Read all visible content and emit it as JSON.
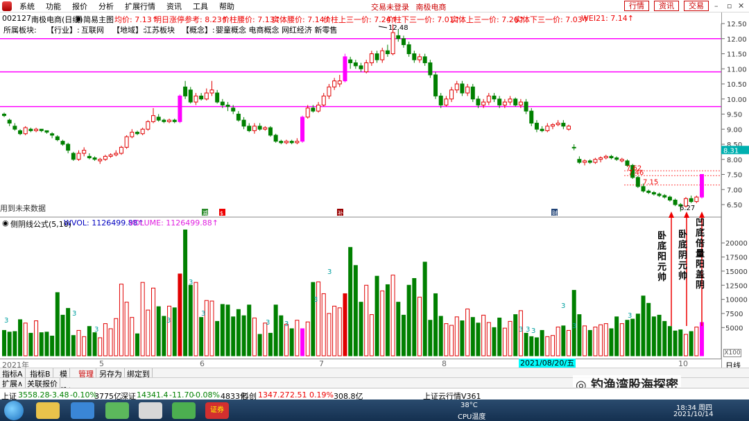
{
  "menubar": {
    "items": [
      "系统",
      "功能",
      "报价",
      "分析",
      "扩展行情",
      "资讯",
      "工具",
      "帮助"
    ],
    "center_status": "交易未登录",
    "center_name": "南极电商",
    "buttons": [
      "行情",
      "资讯",
      "交易"
    ]
  },
  "infobar": {
    "code": "002127",
    "name": "南极电商(日线)",
    "template": "简易主图",
    "avg_price": "均价: 7.13↑",
    "limit_up_ref": "明日涨停参考: 8.23↑",
    "pivot_price": "价柱腰价: 7.13↑",
    "solid_waist": "实体腰价: 7.14↑",
    "upper_third": "价柱上三一价: 7.24↑",
    "lower_third": "价柱下三一价: 7.01↑",
    "solid_upper_third": "实体上三一价: 7.26↑",
    "solid_lower_third": "实体下三一价: 7.03↑",
    "wei21": "WEI21: 7.14↑"
  },
  "conceptbar": {
    "prefix": "所属板块:",
    "industry_label": "【行业】:",
    "industry_value": "互联网",
    "region_label": "【地域】:",
    "region_value": "江苏板块",
    "concept_label": "【概念】:",
    "concept_value": "婴童概念 电商概念 网红经济 新零售"
  },
  "chart_labels": {
    "peak": "12.48",
    "low": "6.27",
    "level_762": "7.62",
    "level_746": "7.46",
    "level_715": "7.15",
    "future_note": "用到未来数据",
    "current_price": "8.31",
    "marker_1": "减",
    "marker_2": "$",
    "marker_3": "补",
    "marker_4": "财"
  },
  "annotations": [
    "卧底阳元帅",
    "卧底阴元帅",
    "凹底倍量阳盖阴"
  ],
  "price_axis": [
    "12.50",
    "12.00",
    "11.50",
    "11.00",
    "10.50",
    "10.00",
    "9.50",
    "9.00",
    "8.50",
    "8.00",
    "7.50",
    "7.00",
    "6.50"
  ],
  "volume_header": {
    "title": "侧阴线公式(5,10)",
    "wvol": "WVOL: 1126499.88↑",
    "volume": "VOLUME: 1126499.88↑"
  },
  "volume_axis": [
    "20000",
    "17500",
    "15000",
    "12500",
    "10000",
    "7500",
    "5000"
  ],
  "volume_marker": "3",
  "x100": "X100",
  "months": [
    "2021年",
    "5",
    "6",
    "7",
    "8",
    "9",
    "10"
  ],
  "date_badge": "2021/08/20/五",
  "period": "日线",
  "tabs": [
    "指标A",
    "指标B",
    "模板",
    "管理",
    "另存为",
    "绑定到"
  ],
  "active_tab": "管理",
  "tabs2": [
    "扩展∧",
    "关联报价"
  ],
  "ticker": {
    "sh_label": "上证",
    "sh_value": "3558.28",
    "sh_change": "-3.48",
    "sh_pct": "-0.10%",
    "sh_amount": "3775亿",
    "sz_label": "深证",
    "sz_value": "14341.4",
    "sz_change": "-11.70",
    "sz_pct": "-0.08%",
    "sz_amount": "4833亿",
    "kc_label": "科创",
    "kc_value": "1347.27",
    "kc_change": "2.51",
    "kc_pct": "0.19%",
    "kc_amount": "308.8亿",
    "cloud": "上证云行情V361"
  },
  "wechat": "钓渔湾股海探密",
  "taskbar": {
    "temp": "38°C",
    "cpu": "CPU温度",
    "time": "18:34 周四",
    "date": "2021/10/14",
    "stock_app": "证券"
  },
  "colors": {
    "up": "#e00000",
    "down": "#008000",
    "magenta": "#ff00ff",
    "accent": "#c00000"
  }
}
